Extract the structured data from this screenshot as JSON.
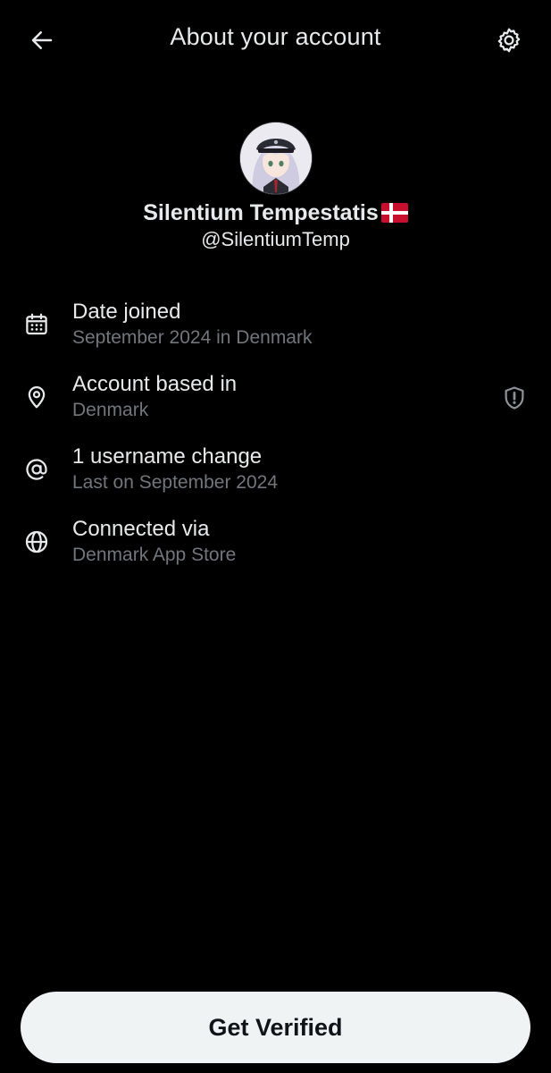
{
  "header": {
    "title": "About your account",
    "back_icon": "arrow-left-icon",
    "settings_icon": "gear-icon"
  },
  "profile": {
    "display_name": "Silentium Tempestatis",
    "flag": "Denmark flag",
    "handle": "@SilentiumTemp"
  },
  "info": [
    {
      "icon": "calendar-icon",
      "label": "Date joined",
      "value": "September 2024 in Denmark"
    },
    {
      "icon": "location-pin-icon",
      "label": "Account based in",
      "value": "Denmark",
      "action_icon": "shield-alert-icon"
    },
    {
      "icon": "at-sign-icon",
      "label": "1 username change",
      "value": "Last on September 2024"
    },
    {
      "icon": "globe-icon",
      "label": "Connected via",
      "value": "Denmark App Store"
    }
  ],
  "footer": {
    "verify_label": "Get Verified"
  },
  "colors": {
    "background": "#000000",
    "primary_text": "#e7e9ea",
    "secondary_text": "#71767b",
    "button_bg": "#eff3f4",
    "button_text": "#0f1419",
    "flag_red": "#c8102e"
  }
}
